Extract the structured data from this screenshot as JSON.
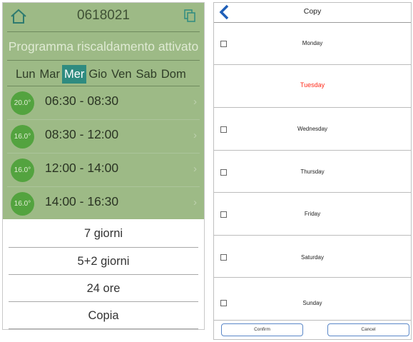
{
  "schedule": {
    "device_id": "0618021",
    "status": "Programma riscaldamento attivato",
    "days": [
      {
        "label": "Lun",
        "active": false
      },
      {
        "label": "Mar",
        "active": false
      },
      {
        "label": "Mer",
        "active": true
      },
      {
        "label": "Gio",
        "active": false
      },
      {
        "label": "Ven",
        "active": false
      },
      {
        "label": "Sab",
        "active": false
      },
      {
        "label": "Dom",
        "active": false
      }
    ],
    "slots": [
      {
        "temp": "20.0°",
        "time": "06:30 - 08:30",
        "chevron": "›"
      },
      {
        "temp": "16.0°",
        "time": "08:30 - 12:00",
        "chevron": "›"
      },
      {
        "temp": "16.0°",
        "time": "12:00 - 14:00",
        "chevron": "›"
      },
      {
        "temp": "16.0°",
        "time": "14:00 - 16:30",
        "chevron": "›"
      }
    ],
    "menu": [
      {
        "label": "7 giorni"
      },
      {
        "label": "5+2 giorni"
      },
      {
        "label": "24 ore"
      },
      {
        "label": "Copia"
      }
    ]
  },
  "copy_dialog": {
    "title": "Copy",
    "days": [
      {
        "label": "Monday",
        "selected": false,
        "has_checkbox": true
      },
      {
        "label": "Tuesday",
        "selected": true,
        "has_checkbox": false
      },
      {
        "label": "Wednesday",
        "selected": false,
        "has_checkbox": true
      },
      {
        "label": "Thursday",
        "selected": false,
        "has_checkbox": true
      },
      {
        "label": "Friday",
        "selected": false,
        "has_checkbox": true
      },
      {
        "label": "Saturday",
        "selected": false,
        "has_checkbox": true
      },
      {
        "label": "Sunday",
        "selected": false,
        "has_checkbox": true
      }
    ],
    "confirm_label": "Confirm",
    "cancel_label": "Cancel"
  },
  "colors": {
    "panel_green": "#9dba86",
    "active_day": "#2f8b80",
    "temp_circle": "#53a33f",
    "selected_day_text": "#ff2a1a",
    "button_border": "#5a87c8"
  }
}
